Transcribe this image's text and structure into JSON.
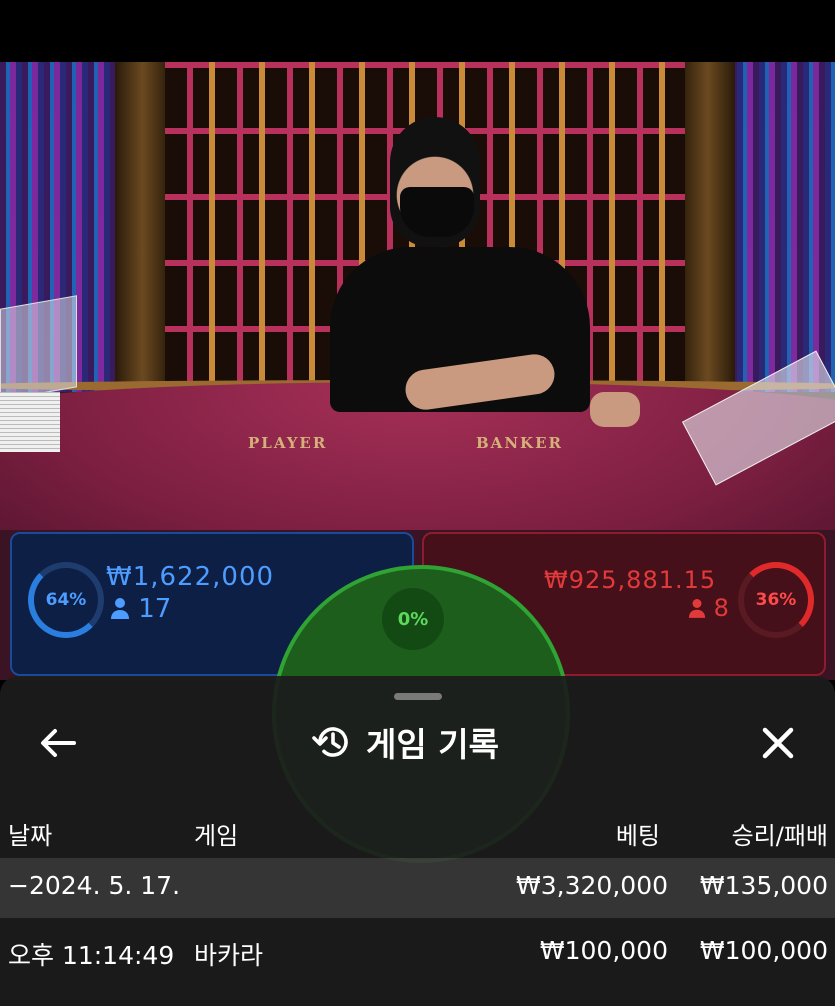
{
  "table": {
    "player_label": "PLAYER",
    "banker_label": "BANKER"
  },
  "bets": {
    "player": {
      "percent": "64%",
      "amount": "₩1,622,000",
      "players": "17",
      "color": "#2a7ee0"
    },
    "banker": {
      "percent": "36%",
      "amount": "₩925,881.15",
      "players": "8",
      "color": "#e02a2a"
    },
    "tie": {
      "percent": "0%",
      "color": "#2fa334"
    }
  },
  "history": {
    "title": "게임 기록",
    "icons": {
      "back": "arrow-left-icon",
      "title": "history-icon",
      "close": "close-icon"
    },
    "columns": {
      "date": "날짜",
      "game": "게임",
      "bet": "베팅",
      "result": "승리/패배"
    },
    "summary": {
      "date": "−2024. 5. 17.",
      "bet": "₩3,320,000",
      "result": "₩135,000"
    },
    "rows": [
      {
        "time": "오후 11:14:49",
        "game": "바카라",
        "bet": "₩100,000",
        "result": "₩100,000"
      }
    ]
  }
}
